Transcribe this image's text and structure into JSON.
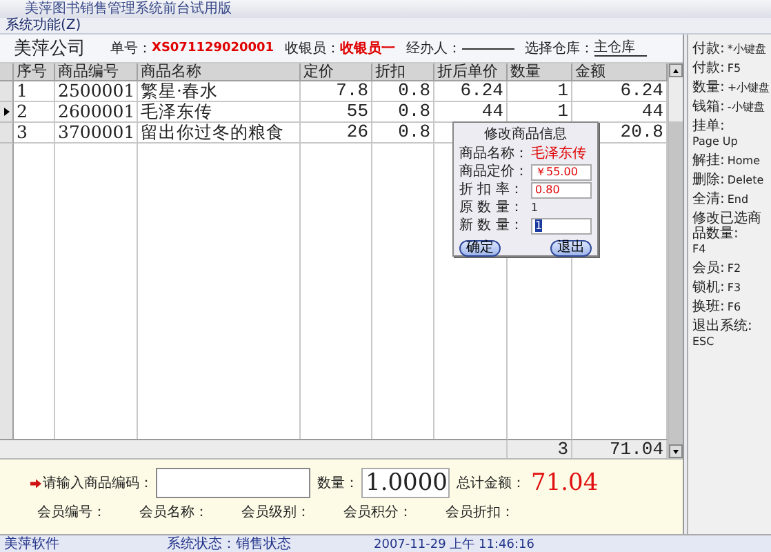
{
  "window": {
    "title": "美萍图书销售管理系统前台试用版"
  },
  "menu": [
    {
      "label": "系统功能(Z)"
    }
  ],
  "header": {
    "company": "美萍公司",
    "fields": [
      {
        "label": "单号：",
        "value": "XS071129020001",
        "kind": "red"
      },
      {
        "label": "收银员：",
        "value": "收银员一",
        "kind": "red"
      },
      {
        "label": "经办人：",
        "kind": "line"
      },
      {
        "label": "选择仓库：",
        "value": "主仓库",
        "kind": "line"
      }
    ]
  },
  "table": {
    "columns": [
      "序号",
      "商品编号",
      "商品名称",
      "定价",
      "折扣",
      "折后单价",
      "数量",
      "金额"
    ],
    "rows": [
      {
        "selected": false,
        "cells": [
          "1",
          "2500001",
          "繁星·春水",
          "7.8",
          "0.8",
          "6.24",
          "1",
          "6.24"
        ]
      },
      {
        "selected": true,
        "cells": [
          "2",
          "2600001",
          "毛泽东传",
          "55",
          "0.8",
          "44",
          "1",
          "44"
        ]
      },
      {
        "selected": false,
        "cells": [
          "3",
          "3700001",
          "留出你过冬的粮食",
          "26",
          "0.8",
          null,
          null,
          "20.8"
        ]
      }
    ],
    "totals": {
      "quantity": "3",
      "amount": "71.04"
    }
  },
  "dialog": {
    "title": "修改商品信息",
    "rows": [
      {
        "label": "商品名称：",
        "value": "毛泽东传",
        "kind": "text"
      },
      {
        "label": "商品定价：",
        "value": "￥55.00",
        "kind": "input"
      },
      {
        "label": "折 扣 率：",
        "value": "0.80",
        "kind": "input"
      },
      {
        "label": "原 数 量：",
        "value": "1",
        "kind": "plain"
      },
      {
        "label": "新 数 量：",
        "value": "1",
        "kind": "active"
      }
    ],
    "buttons": [
      "确定",
      "退出"
    ]
  },
  "entry": {
    "code_label": "请输入商品编码：",
    "qty_label": "数量：",
    "qty_value": "1.0000",
    "total_label": "总计金额：",
    "total_value": "71.04",
    "member_fields": [
      "会员编号：",
      "会员名称：",
      "会员级别：",
      "会员积分：",
      "会员折扣："
    ]
  },
  "shortcuts": [
    {
      "label": "付款:",
      "key": "*小键盘"
    },
    {
      "label": "付款:",
      "key": "F5"
    },
    {
      "label": "数量:",
      "key": "+小键盘"
    },
    {
      "label": "钱箱:",
      "key": "-小键盘"
    },
    {
      "label": "挂单:",
      "key": "Page Up"
    },
    {
      "label": "解挂:",
      "key": "Home"
    },
    {
      "label": "删除:",
      "key": "Delete"
    },
    {
      "label": "全清:",
      "key": "End"
    },
    {
      "label": "修改已选商品数量:",
      "key": "F4"
    },
    {
      "label": "会员:",
      "key": "F2"
    },
    {
      "label": "锁机:",
      "key": "F3"
    },
    {
      "label": "换班:",
      "key": "F6"
    },
    {
      "label": "退出系统:",
      "key": "ESC"
    }
  ],
  "status_bar": [
    "美萍软件",
    "系统状态：销售状态",
    "2007-11-29 上午 11:46:16"
  ]
}
